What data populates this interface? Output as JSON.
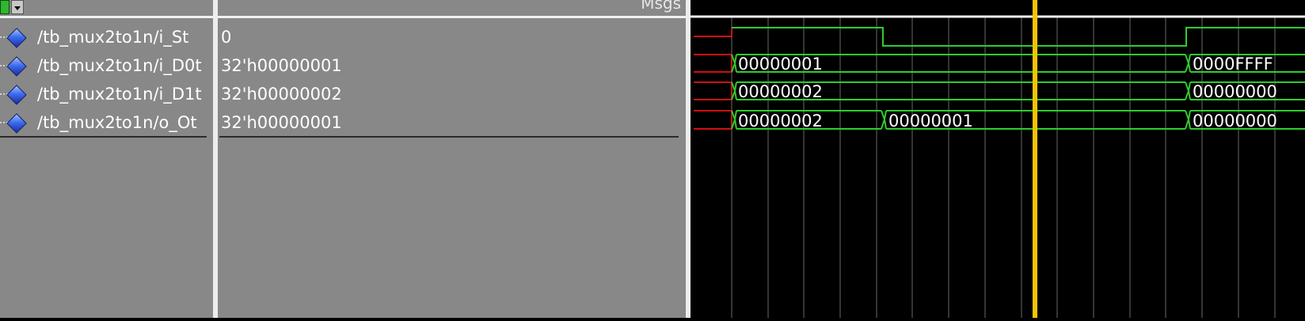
{
  "header": {
    "values_label": "Msgs"
  },
  "signals": [
    {
      "name": "/tb_mux2to1n/i_St",
      "value": "0"
    },
    {
      "name": "/tb_mux2to1n/i_D0t",
      "value": "32'h00000001"
    },
    {
      "name": "/tb_mux2to1n/i_D1t",
      "value": "32'h00000002"
    },
    {
      "name": "/tb_mux2to1n/o_Ot",
      "value": "32'h00000001"
    }
  ],
  "waves": {
    "cursor_color": "#f5c400",
    "wave_color": "#2ecc2e",
    "initial_color": "#d01010",
    "i_St": [
      "low",
      "high",
      "low",
      "high"
    ],
    "i_D0t": [
      "00000001",
      "0000FFFF"
    ],
    "i_D1t": [
      "00000002",
      "00000000"
    ],
    "o_Ot": [
      "00000002",
      "00000001",
      "00000000"
    ]
  }
}
